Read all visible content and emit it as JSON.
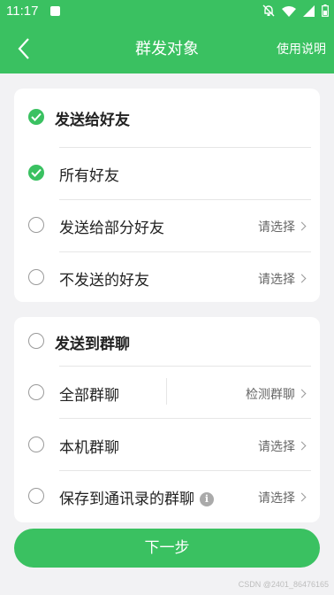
{
  "status_bar": {
    "time": "11:17"
  },
  "nav": {
    "title": "群发对象",
    "help": "使用说明"
  },
  "friends": {
    "header": "发送给好友",
    "all": "所有好友",
    "partial": {
      "label": "发送给部分好友",
      "action": "请选择"
    },
    "exclude": {
      "label": "不发送的好友",
      "action": "请选择"
    }
  },
  "groups": {
    "header": "发送到群聊",
    "all": {
      "label": "全部群聊",
      "action": "检测群聊"
    },
    "local": {
      "label": "本机群聊",
      "action": "请选择"
    },
    "saved": {
      "label": "保存到通讯录的群聊",
      "action": "请选择",
      "info": "i"
    }
  },
  "next_button": "下一步",
  "watermark": "CSDN @2401_86476165",
  "colors": {
    "accent": "#3ac161",
    "background": "#f2f2f4"
  }
}
